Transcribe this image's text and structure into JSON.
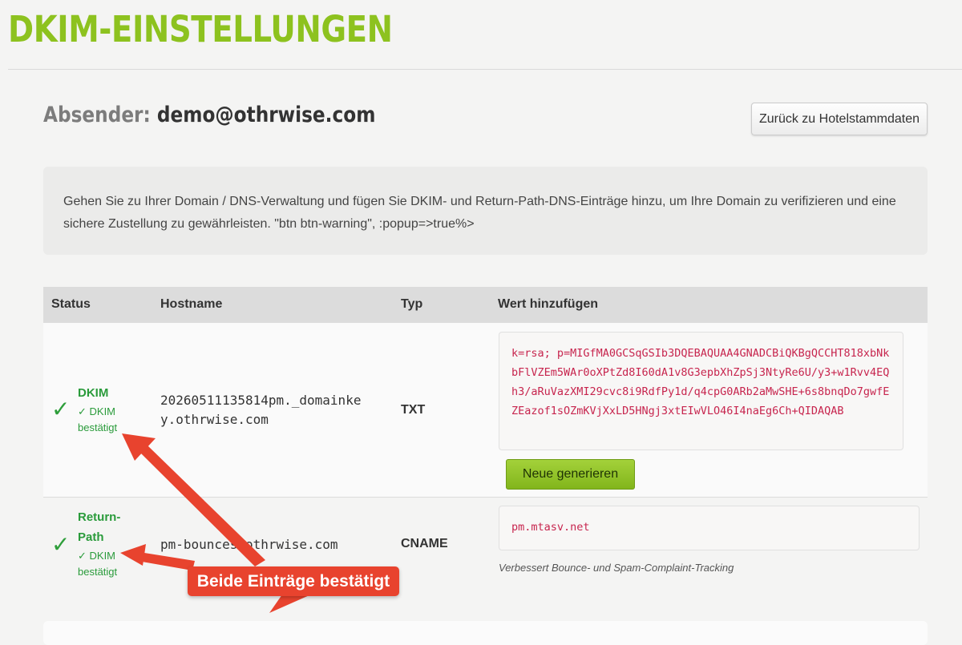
{
  "page": {
    "title": "DKIM-EINSTELLUNGEN"
  },
  "sender": {
    "label": "Absender:",
    "email": "demo@othrwise.com",
    "back_button": "Zurück zu Hotelstammdaten"
  },
  "info": {
    "text": "Gehen Sie zu Ihrer Domain / DNS-Verwaltung und fügen Sie DKIM- und Return-Path-DNS-Einträge hinzu, um Ihre Domain zu verifizieren und eine sichere Zustellung zu gewährleisten. \"btn btn-warning\", :popup=>true%>"
  },
  "table": {
    "headers": [
      "Status",
      "Hostname",
      "Typ",
      "Wert hinzufügen"
    ],
    "rows": [
      {
        "status_icon": "check-icon",
        "status_title": "DKIM",
        "status_sub_line1": "✓ DKIM",
        "status_sub_line2": "bestätigt",
        "hostname_line1": "20260511135814pm._domainke",
        "hostname_line2": "y.othrwise.com",
        "type": "TXT",
        "value": "k=rsa; p=MIGfMA0GCSqGSIb3DQEBAQUAA4GNADCBiQKBgQCCHT818xbNkbFlVZEm5WAr0oXPtZd8I60dA1v8G3epbXhZpSj3NtyRe6U/y3+w1Rvv4EQh3/aRuVazXMI29cvc8i9RdfPy1d/q4cpG0ARb2aMwSHE+6s8bnqDo7gwfEZEazof1sOZmKVjXxLD5HNgj3xtEIwVLO46I4naEg6Ch+QIDAQAB",
        "action": "Neue generieren"
      },
      {
        "status_icon": "check-icon",
        "status_title_line1": "Return-",
        "status_title_line2": "Path",
        "status_sub_line1": "✓ DKIM",
        "status_sub_line2": "bestätigt",
        "hostname": "pm-bounces.othrwise.com",
        "type": "CNAME",
        "value": "pm.mtasv.net",
        "note": "Verbessert Bounce- und Spam-Complaint-Tracking"
      }
    ]
  },
  "annotation": {
    "label": "Beide Einträge bestätigt",
    "color": "#e8432e"
  },
  "colors": {
    "brand_green": "#8dc21f",
    "status_green": "#2a9b3b",
    "code_red": "#c7254e"
  }
}
